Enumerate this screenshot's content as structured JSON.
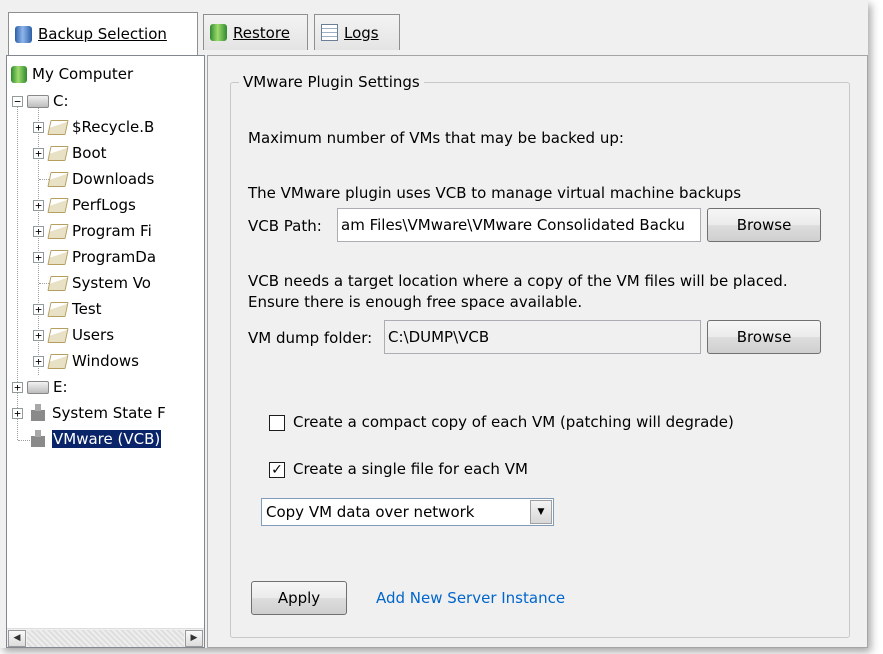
{
  "tabs": [
    {
      "label": "Backup Selection",
      "icon": "database-icon",
      "active": true
    },
    {
      "label": "Restore",
      "icon": "database-green-icon",
      "active": false
    },
    {
      "label": "Logs",
      "icon": "log-icon",
      "active": false
    }
  ],
  "tree": {
    "root": "My Computer",
    "drive_c": "C:",
    "folders": [
      "$Recycle.B",
      "Boot",
      "Downloads",
      "PerfLogs",
      "Program Fi",
      "ProgramDa",
      "System Vo",
      "Test",
      "Users",
      "Windows"
    ],
    "drive_e": "E:",
    "system_state": "System State F",
    "vmware": "VMware (VCB)"
  },
  "settings": {
    "group_title": "VMware Plugin Settings",
    "max_vms_label": "Maximum number of VMs that may be backed up:",
    "vcb_info": "The VMware plugin uses VCB to manage virtual machine backups",
    "vcb_path_label": "VCB Path:",
    "vcb_path_value": "am Files\\VMware\\VMware Consolidated Backu",
    "browse_label": "Browse",
    "target_info_1": "VCB needs a target location where a copy of the VM files will be placed.",
    "target_info_2": "Ensure there is enough free space available.",
    "dump_label": "VM dump folder:",
    "dump_value": "C:\\DUMP\\VCB",
    "compact_label": "Create a compact copy of each VM (patching will degrade)",
    "compact_checked": false,
    "single_file_label": "Create a single file for each VM",
    "single_file_checked": true,
    "transfer_mode": "Copy VM data over network",
    "apply_label": "Apply",
    "add_instance_label": "Add New Server Instance"
  },
  "colors": {
    "selection": "#0a246a",
    "link": "#0066cc",
    "panel_bg": "#f0f0f0"
  }
}
